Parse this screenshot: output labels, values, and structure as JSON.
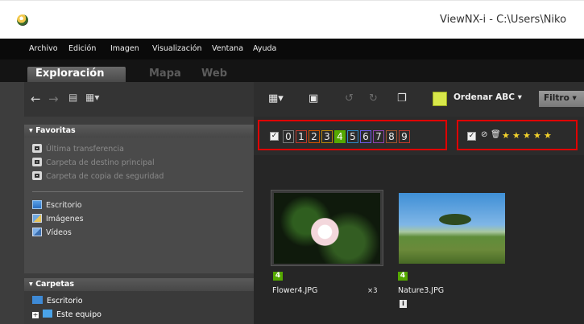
{
  "window": {
    "title": "ViewNX-i - C:\\Users\\Niko"
  },
  "menu": [
    "Archivo",
    "Edición",
    "Imagen",
    "Visualización",
    "Ventana",
    "Ayuda"
  ],
  "tabs": [
    {
      "label": "Exploración",
      "active": true
    },
    {
      "label": "Mapa",
      "active": false
    },
    {
      "label": "Web",
      "active": false
    }
  ],
  "favorites": {
    "header": "Favoritas",
    "items": [
      "Última transferencia",
      "Carpeta de destino principal",
      "Carpeta de copia de seguridad"
    ],
    "library": [
      "Escritorio",
      "Imágenes",
      "Vídeos"
    ]
  },
  "folders": {
    "header": "Carpetas",
    "items": [
      "Escritorio",
      "Este equipo"
    ]
  },
  "toolbar": {
    "sort_label": "Ordenar ABC",
    "filter_label": "Filtro"
  },
  "filters": {
    "labels": [
      "0",
      "1",
      "2",
      "3",
      "4",
      "5",
      "6",
      "7",
      "8",
      "9"
    ],
    "label_colors": [
      "#7a7a7a",
      "#c0392b",
      "#d35400",
      "#b8860b",
      "#55a800",
      "#2e86c1",
      "#6c5ce7",
      "#8e44ad",
      "#a0522d",
      "#c0392b"
    ],
    "stars": 5
  },
  "thumbnails": [
    {
      "name": "Flower4.JPG",
      "label_value": "4",
      "extra": "×3"
    },
    {
      "name": "Nature3.JPG",
      "label_value": "4",
      "extra": ""
    }
  ]
}
